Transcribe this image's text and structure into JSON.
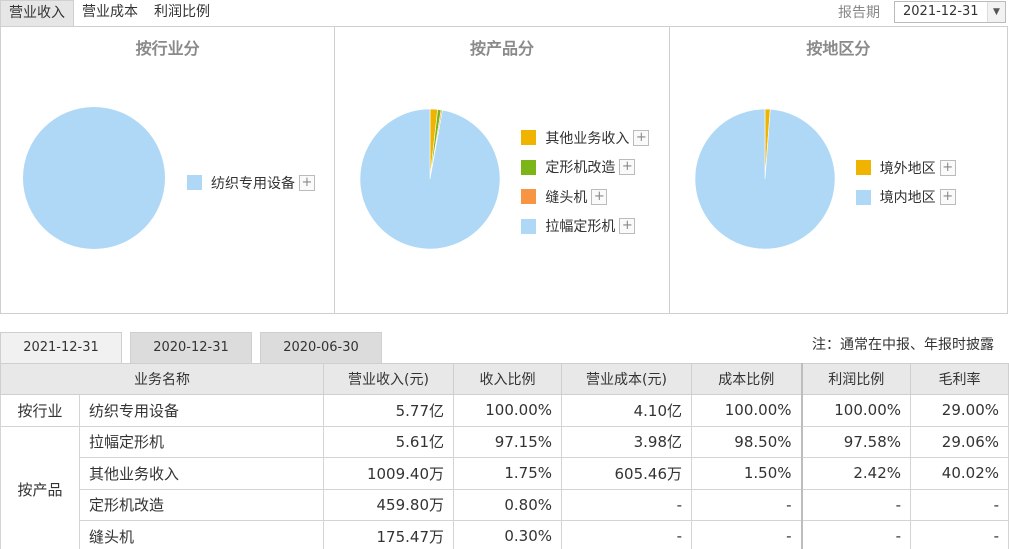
{
  "top_tabs": [
    {
      "label": "营业收入",
      "active": true
    },
    {
      "label": "营业成本",
      "active": false
    },
    {
      "label": "利润比例",
      "active": false
    }
  ],
  "report_period_label": "报告期",
  "report_period_value": "2021-12-31",
  "pies": [
    {
      "title": "按行业分",
      "slices": [
        {
          "label": "纺织专用设备",
          "value": 100.0,
          "color": "#aed8f5"
        }
      ]
    },
    {
      "title": "按产品分",
      "slices": [
        {
          "label": "其他业务收入",
          "value": 1.75,
          "color": "#f0b400"
        },
        {
          "label": "定形机改造",
          "value": 0.8,
          "color": "#7cb518"
        },
        {
          "label": "缝头机",
          "value": 0.3,
          "color": "#f79545"
        },
        {
          "label": "拉幅定形机",
          "value": 97.15,
          "color": "#aed8f5"
        }
      ]
    },
    {
      "title": "按地区分",
      "slices": [
        {
          "label": "境外地区",
          "value": 1.2,
          "color": "#f0b400"
        },
        {
          "label": "境内地区",
          "value": 98.8,
          "color": "#aed8f5"
        }
      ]
    }
  ],
  "plus_glyph": "+",
  "date_tabs": [
    {
      "label": "2021-12-31",
      "active": true
    },
    {
      "label": "2020-12-31",
      "active": false
    },
    {
      "label": "2020-06-30",
      "active": false
    }
  ],
  "note": "注：通常在中报、年报时披露",
  "table": {
    "headers": [
      "业务名称",
      "营业收入(元)",
      "收入比例",
      "营业成本(元)",
      "成本比例",
      "利润比例",
      "毛利率"
    ],
    "groups": [
      {
        "label": "按行业",
        "rows": [
          [
            "纺织专用设备",
            "5.77亿",
            "100.00%",
            "4.10亿",
            "100.00%",
            "100.00%",
            "29.00%"
          ]
        ]
      },
      {
        "label": "按产品",
        "rows": [
          [
            "拉幅定形机",
            "5.61亿",
            "97.15%",
            "3.98亿",
            "98.50%",
            "97.58%",
            "29.06%"
          ],
          [
            "其他业务收入",
            "1009.40万",
            "1.75%",
            "605.46万",
            "1.50%",
            "2.42%",
            "40.02%"
          ],
          [
            "定形机改造",
            "459.80万",
            "0.80%",
            "-",
            "-",
            "-",
            "-"
          ],
          [
            "缝头机",
            "175.47万",
            "0.30%",
            "-",
            "-",
            "-",
            "-"
          ]
        ]
      }
    ]
  }
}
